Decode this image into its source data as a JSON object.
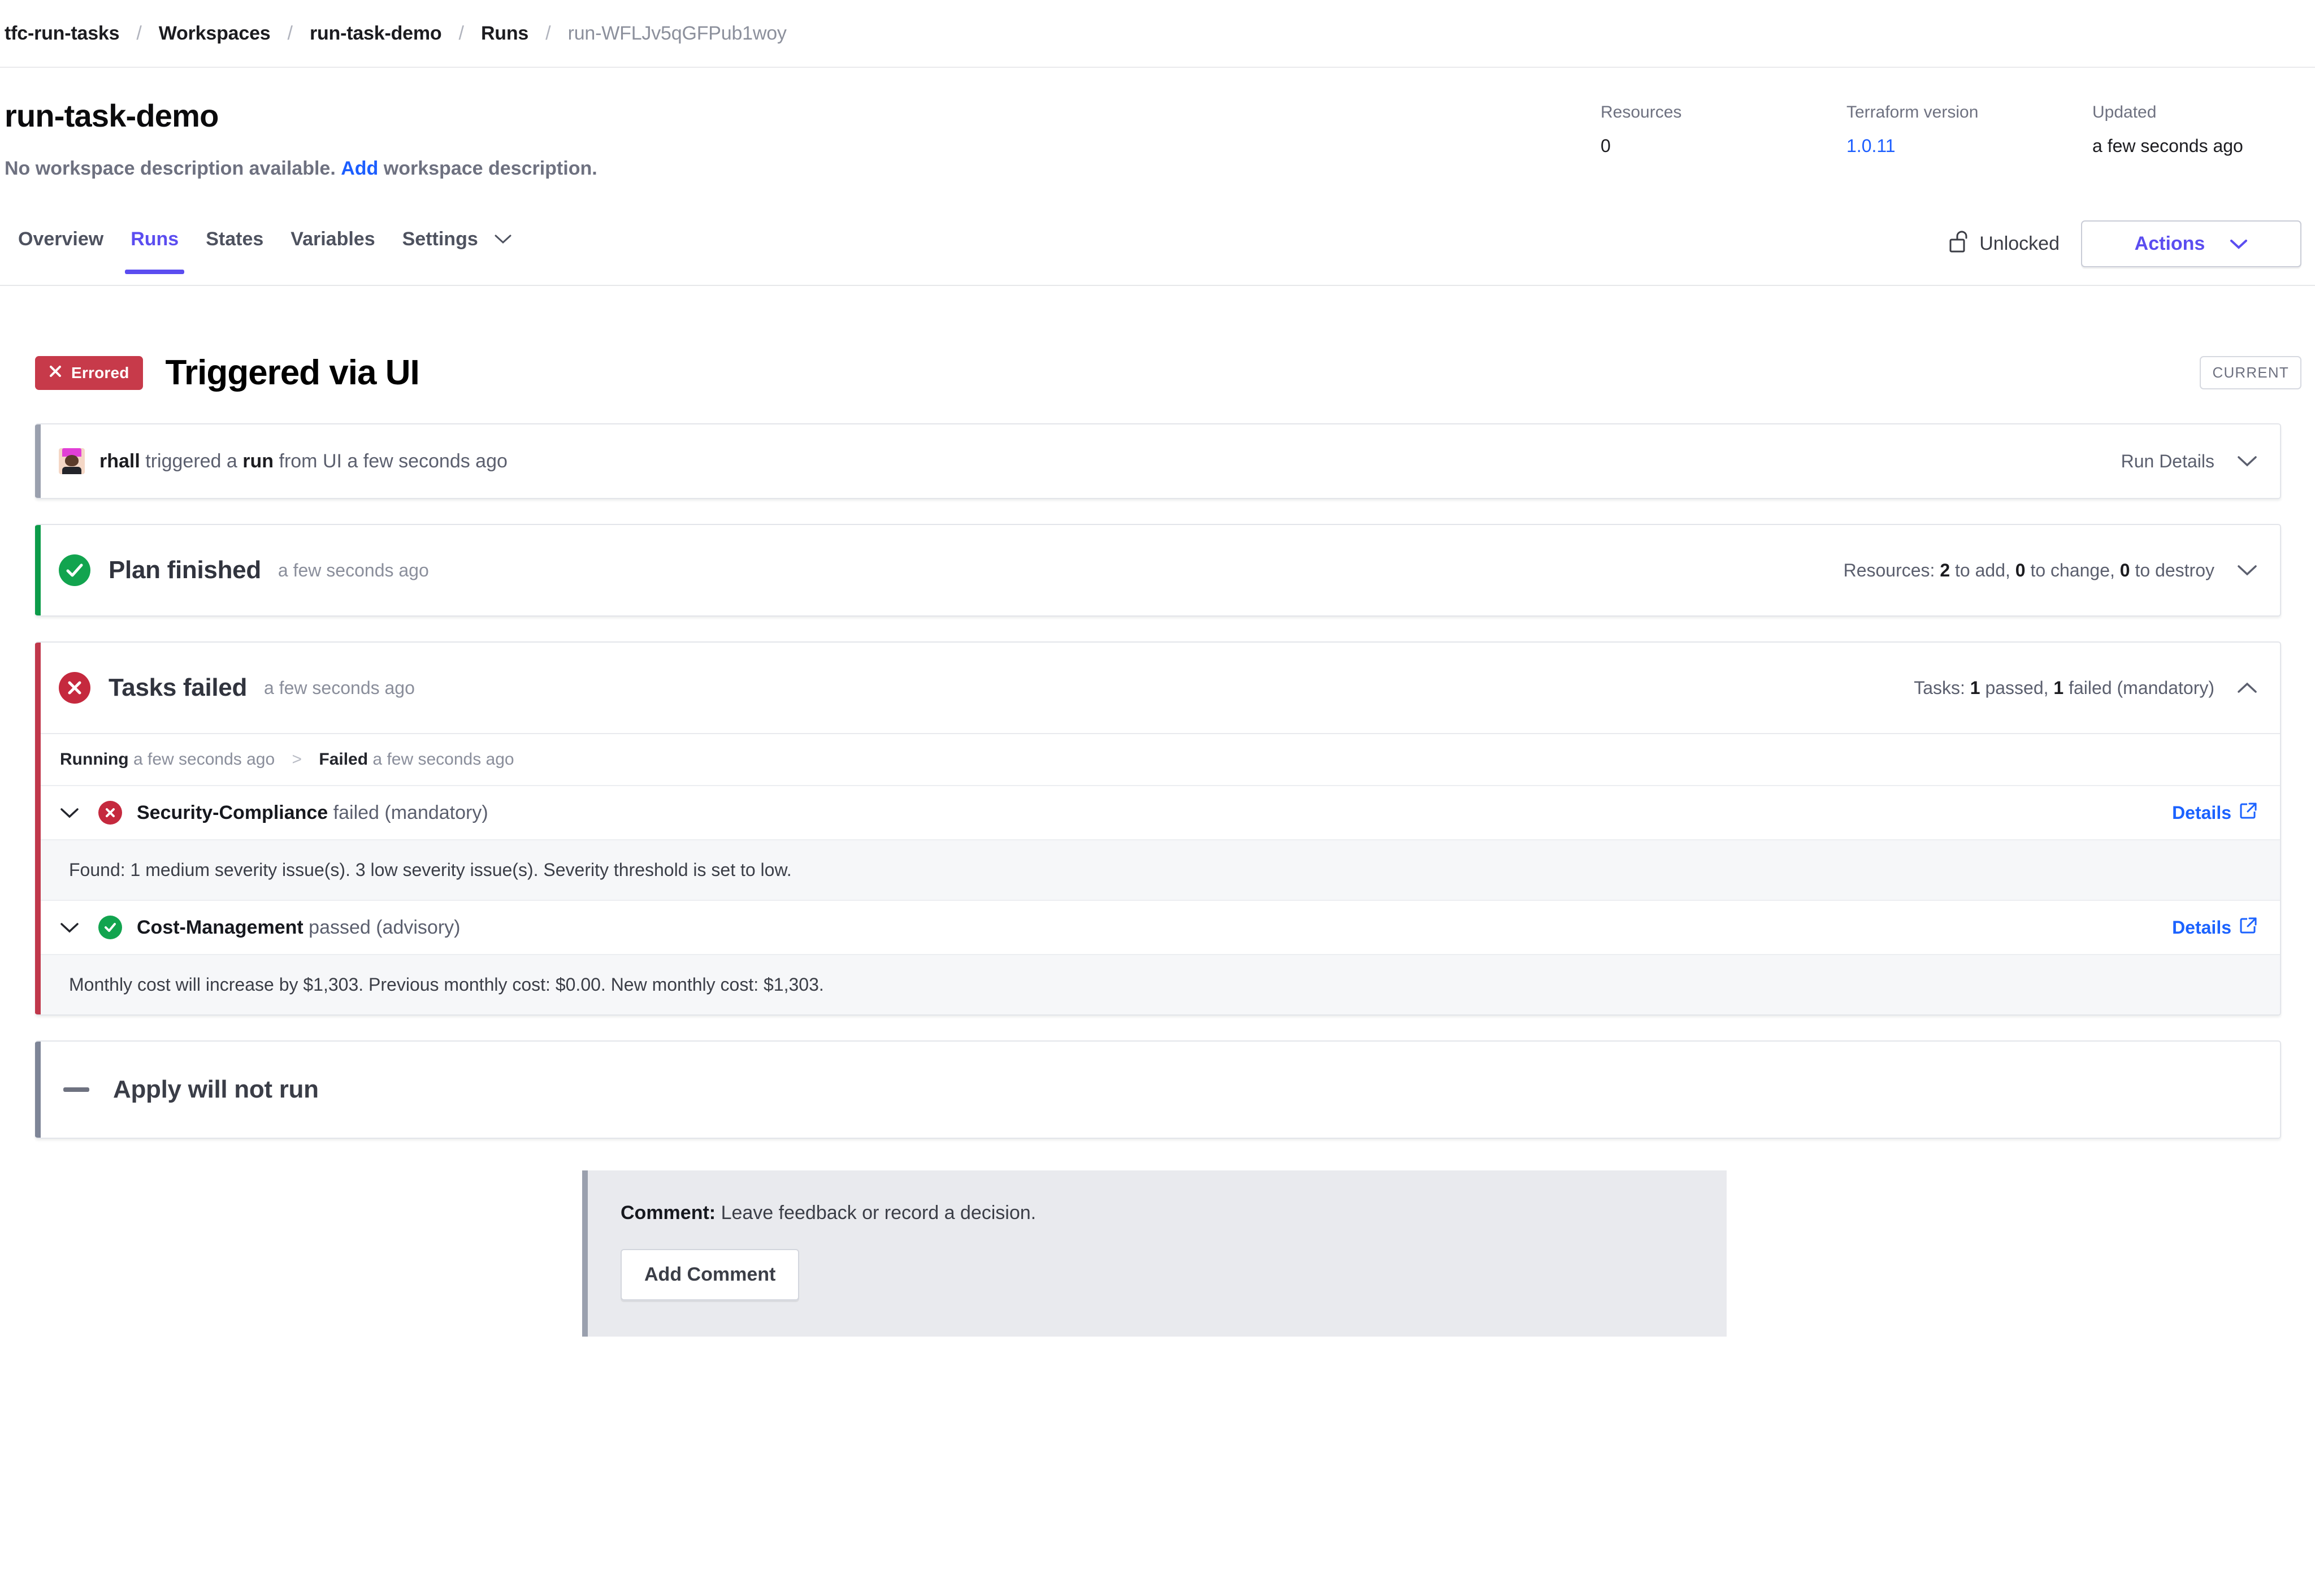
{
  "breadcrumb": {
    "items": [
      {
        "label": "tfc-run-tasks",
        "current": false
      },
      {
        "label": "Workspaces",
        "current": false
      },
      {
        "label": "run-task-demo",
        "current": false
      },
      {
        "label": "Runs",
        "current": false
      },
      {
        "label": "run-WFLJv5qGFPub1woy",
        "current": true
      }
    ],
    "separator": "/"
  },
  "workspace": {
    "title": "run-task-demo",
    "description_prefix": "No workspace description available.",
    "description_link": "Add",
    "description_suffix": "workspace description.",
    "meta": [
      {
        "label": "Resources",
        "value": "0",
        "is_link": false
      },
      {
        "label": "Terraform version",
        "value": "1.0.11",
        "is_link": true
      },
      {
        "label": "Updated",
        "value": "a few seconds ago",
        "is_link": false
      }
    ]
  },
  "tabs": [
    {
      "label": "Overview",
      "active": false,
      "has_caret": false
    },
    {
      "label": "Runs",
      "active": true,
      "has_caret": false
    },
    {
      "label": "States",
      "active": false,
      "has_caret": false
    },
    {
      "label": "Variables",
      "active": false,
      "has_caret": false
    },
    {
      "label": "Settings",
      "active": false,
      "has_caret": true
    }
  ],
  "toolbar": {
    "lock_status": "Unlocked",
    "actions_label": "Actions"
  },
  "run": {
    "status_badge": "Errored",
    "title": "Triggered via UI",
    "current_chip": "CURRENT"
  },
  "trigger_card": {
    "user": "rhall",
    "text_1": "triggered a",
    "kind": "run",
    "text_2": "from UI a few seconds ago",
    "right_label": "Run Details"
  },
  "plan_card": {
    "title": "Plan finished",
    "time": "a few seconds ago",
    "summary_prefix": "Resources:",
    "add_count": "2",
    "add_label": "to add,",
    "change_count": "0",
    "change_label": "to change,",
    "destroy_count": "0",
    "destroy_label": "to destroy"
  },
  "tasks_card": {
    "title": "Tasks failed",
    "time": "a few seconds ago",
    "summary_prefix": "Tasks:",
    "passed_count": "1",
    "passed_label": "passed,",
    "failed_count": "1",
    "failed_label": "failed (mandatory)",
    "timeline": {
      "running_label": "Running",
      "running_time": "a few seconds ago",
      "separator": ">",
      "failed_label": "Failed",
      "failed_time": "a few seconds ago"
    },
    "tasks": [
      {
        "name": "Security-Compliance",
        "status_text": "failed (mandatory)",
        "status": "failed",
        "details_label": "Details",
        "message": "Found: 1 medium severity issue(s). 3 low severity issue(s). Severity threshold is set to low."
      },
      {
        "name": "Cost-Management",
        "status_text": "passed (advisory)",
        "status": "passed",
        "details_label": "Details",
        "message": "Monthly cost will increase by $1,303. Previous monthly cost: $0.00. New monthly cost: $1,303."
      }
    ]
  },
  "apply_card": {
    "title": "Apply will not run"
  },
  "comment_box": {
    "label": "Comment:",
    "placeholder_text": "Leave feedback or record a decision.",
    "button_label": "Add Comment"
  },
  "colors": {
    "accent_purple": "#5b4df0",
    "link_blue": "#1c5eff",
    "error_red": "#c73a4a",
    "success_green": "#12a44f"
  }
}
